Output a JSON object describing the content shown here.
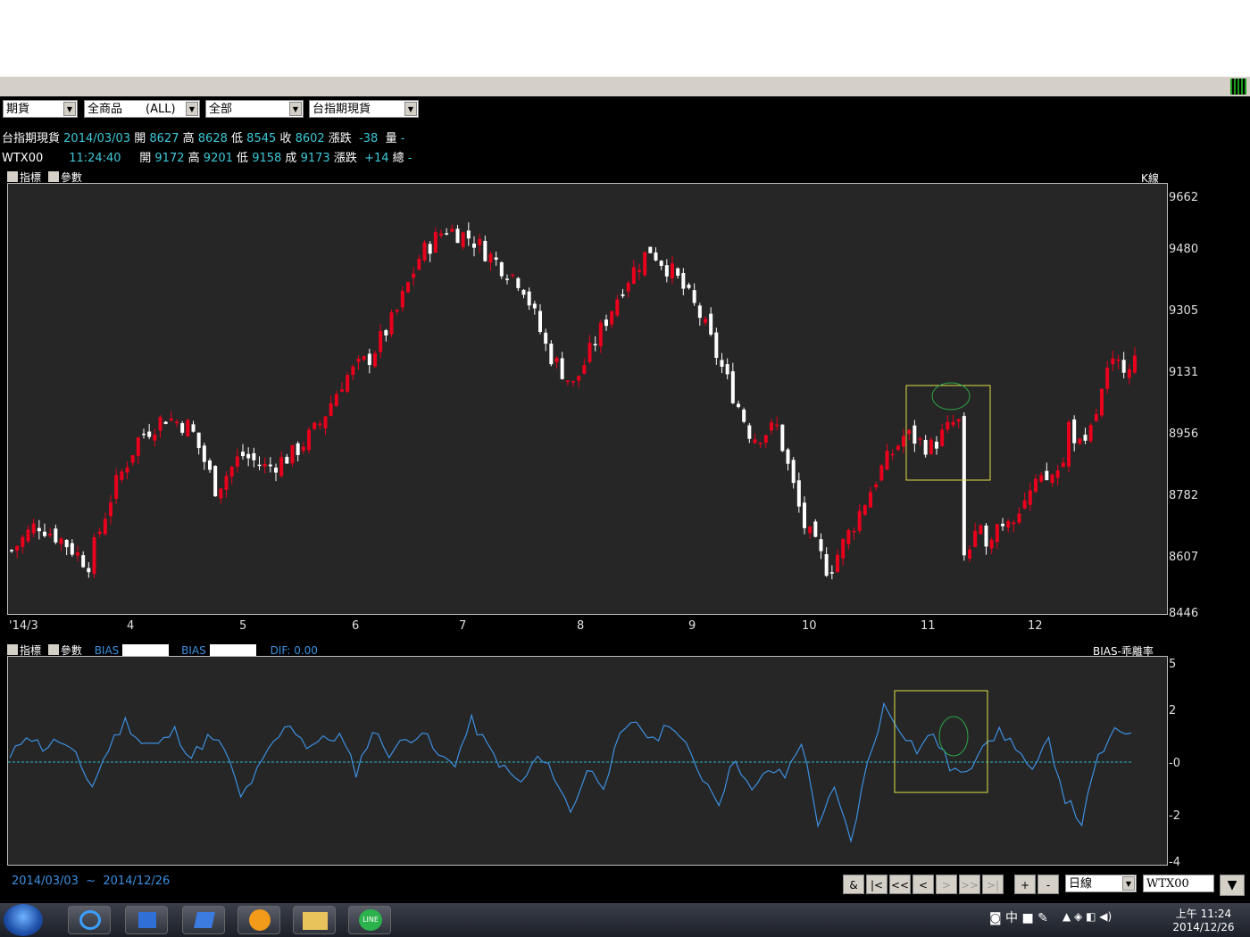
{
  "selectors": [
    "期貨",
    "全商品　　(ALL)",
    "全部",
    "台指期現貨"
  ],
  "quote1": {
    "name": "台指期現貨",
    "date": "2014/03/03",
    "open_label": "開",
    "open": "8627",
    "high_label": "高",
    "high": "8628",
    "low_label": "低",
    "low": "8545",
    "close_label": "收",
    "close": "8602",
    "chg_label": "漲跌",
    "chg": "-38",
    "vol_label": "量",
    "vol": "-"
  },
  "quote2": {
    "name": "WTX00",
    "time": "11:24:40",
    "open_label": "開",
    "open": "9172",
    "high_label": "高",
    "high": "9201",
    "low_label": "低",
    "low": "9158",
    "last_label": "成",
    "last": "9173",
    "chg_label": "漲跌",
    "chg": "+14",
    "total_label": "總",
    "total": "-"
  },
  "panel1": {
    "tab1": "指標",
    "tab2": "參數",
    "right": "K線"
  },
  "panel2": {
    "tab1": "指標",
    "tab2": "參數",
    "bias1": "BIAS",
    "bias2": "BIAS",
    "dif_label": "DIF:",
    "dif": "0.00",
    "right": "BIAS-乖離率"
  },
  "bottom": {
    "range_start": "2014/03/03",
    "range_sep": "~",
    "range_end": "2014/12/26",
    "period": "日線",
    "symbol": "WTX00",
    "nav": [
      "&",
      "|<",
      "<<",
      "<",
      ">",
      ">>",
      ">|",
      "+",
      "-"
    ]
  },
  "taskbar": {
    "ime": "中",
    "time_line1": "上午 11:24",
    "time_line2": "2014/12/26"
  },
  "colors": {
    "up": "#e8001c",
    "down": "#ffffff",
    "bias_line": "#3d8fe0",
    "zero_line": "#2fb8c8",
    "highlight": "#e0e04a",
    "circle": "#2ea84a"
  },
  "chart_data": [
    {
      "type": "candlestick",
      "title": "K線",
      "x_tick_labels": [
        "'14/3",
        "4",
        "5",
        "6",
        "7",
        "8",
        "9",
        "10",
        "11",
        "12"
      ],
      "y_tick_labels": [
        "9662",
        "9480",
        "9305",
        "9131",
        "8956",
        "8782",
        "8607",
        "8446"
      ],
      "ylim": [
        8446,
        9662
      ],
      "close_path": [
        {
          "m": "3",
          "close": 8620
        },
        {
          "m": "3",
          "close": 8700
        },
        {
          "m": "3",
          "close": 8650
        },
        {
          "m": "4",
          "close": 8580
        },
        {
          "m": "4",
          "close": 8800
        },
        {
          "m": "4",
          "close": 8950
        },
        {
          "m": "4",
          "close": 9010
        },
        {
          "m": "4",
          "close": 8980
        },
        {
          "m": "5",
          "close": 8800
        },
        {
          "m": "5",
          "close": 8900
        },
        {
          "m": "5",
          "close": 8860
        },
        {
          "m": "5",
          "close": 8900
        },
        {
          "m": "6",
          "close": 8980
        },
        {
          "m": "6",
          "close": 9120
        },
        {
          "m": "6",
          "close": 9180
        },
        {
          "m": "6",
          "close": 9300
        },
        {
          "m": "7",
          "close": 9480
        },
        {
          "m": "7",
          "close": 9560
        },
        {
          "m": "7",
          "close": 9530
        },
        {
          "m": "7",
          "close": 9460
        },
        {
          "m": "8",
          "close": 9400
        },
        {
          "m": "8",
          "close": 9200
        },
        {
          "m": "8",
          "close": 9100
        },
        {
          "m": "8",
          "close": 9250
        },
        {
          "m": "9",
          "close": 9400
        },
        {
          "m": "9",
          "close": 9500
        },
        {
          "m": "9",
          "close": 9420
        },
        {
          "m": "9",
          "close": 9300
        },
        {
          "m": "10",
          "close": 9120
        },
        {
          "m": "10",
          "close": 8950
        },
        {
          "m": "10",
          "close": 8980
        },
        {
          "m": "10",
          "close": 8700
        },
        {
          "m": "10",
          "close": 8560
        },
        {
          "m": "10",
          "close": 8700
        },
        {
          "m": "11",
          "close": 8850
        },
        {
          "m": "11",
          "close": 8960
        },
        {
          "m": "11",
          "close": 8920
        },
        {
          "m": "11",
          "close": 9000
        },
        {
          "m": "11",
          "close": 8900
        },
        {
          "m": "12",
          "close": 9150
        },
        {
          "m": "12",
          "close": 9200
        },
        {
          "m": "12",
          "close": 9050
        },
        {
          "m": "12",
          "close": 8900
        },
        {
          "m": "12",
          "close": 9150
        },
        {
          "m": "12",
          "close": 9180
        }
      ]
    },
    {
      "type": "line",
      "title": "BIAS-乖離率",
      "y_tick_labels": [
        "5",
        "2",
        "-0",
        "-2",
        "-4"
      ],
      "ylim": [
        -4,
        5
      ],
      "series": [
        {
          "name": "BIAS",
          "values": [
            0.1,
            1.2,
            0.6,
            0.9,
            0.2,
            -1.0,
            0.6,
            1.7,
            0.8,
            0.7,
            1.3,
            0.2,
            1.0,
            0.6,
            -1.5,
            -0.4,
            0.8,
            1.6,
            0.7,
            0.9,
            1.1,
            -0.4,
            1.3,
            0.4,
            0.9,
            1.3,
            0.2,
            0.0,
            1.7,
            0.6,
            -0.3,
            -0.9,
            0.2,
            -0.5,
            -2.1,
            -0.3,
            -0.9,
            1.0,
            1.7,
            0.8,
            1.7,
            0.6,
            -0.6,
            -1.6,
            0.2,
            -1.3,
            -0.3,
            -0.6,
            0.9,
            -2.5,
            -1.2,
            -3.3,
            -0.1,
            2.3,
            1.4,
            0.5,
            1.2,
            -0.2,
            -0.6,
            0.9,
            1.2,
            0.7,
            -0.5,
            0.9,
            -1.5,
            -2.5,
            0.2,
            1.2,
            1.3
          ]
        }
      ]
    }
  ]
}
